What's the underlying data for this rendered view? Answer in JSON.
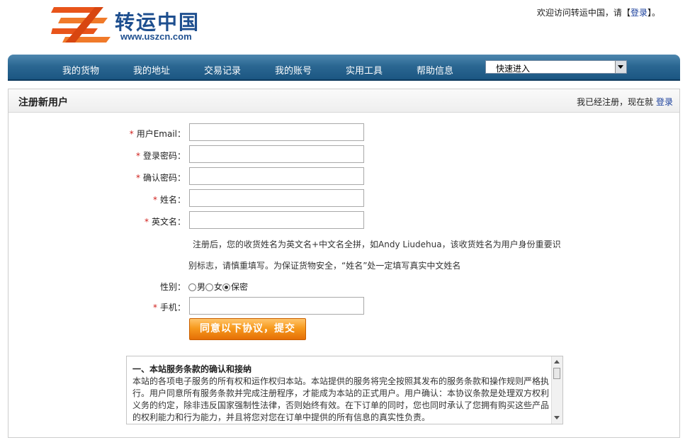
{
  "brand": {
    "name_cn": "转运中国",
    "url": "www.uszcn.com"
  },
  "welcome": {
    "prefix": "欢迎访问转运中国，请",
    "link_open": "【",
    "login": "登录",
    "link_close": "】",
    "suffix": "。"
  },
  "nav": {
    "items": [
      "我的货物",
      "我的地址",
      "交易记录",
      "我的账号",
      "实用工具",
      "帮助信息"
    ],
    "quick_select": "快速进入"
  },
  "panel": {
    "title": "注册新用户",
    "right_text": "我已经注册，现在就",
    "right_link": "登录"
  },
  "form": {
    "required_mark": "*",
    "email_label": "用户Email：",
    "password_label": "登录密码：",
    "confirm_label": "确认密码：",
    "name_label": "姓名：",
    "en_name_label": "英文名：",
    "note_line1": "注册后，您的收货姓名为英文名+中文名全拼，如Andy Liudehua，该收货姓名为用户身份重要识",
    "note_line2": "别标志，请慎重填写。为保证货物安全，“姓名”处一定填写真实中文姓名",
    "gender_label": "性别：",
    "gender_options": [
      "男",
      "女",
      "保密"
    ],
    "gender_selected": "保密",
    "phone_label": "手机：",
    "submit": "同意以下协议，提交"
  },
  "terms": {
    "heading": "一、本站服务条款的确认和接纳",
    "body": "本站的各项电子服务的所有权和运作权归本站。本站提供的服务将完全按照其发布的服务条款和操作规则严格执行。用户同意所有服务条款并完成注册程序，才能成为本站的正式用户。用户确认：本协议条款是处理双方权利义务的约定，除非违反国家强制性法律，否则始终有效。在下订单的同时，您也同时承认了您拥有购买这些产品的权利能力和行为能力，并且将您对您在订单中提供的所有信息的真实性负责。"
  },
  "colors": {
    "nav": "#2b6792",
    "accent_orange": "#f79a1e",
    "link": "#1a3f9c",
    "required": "#d0201c"
  }
}
